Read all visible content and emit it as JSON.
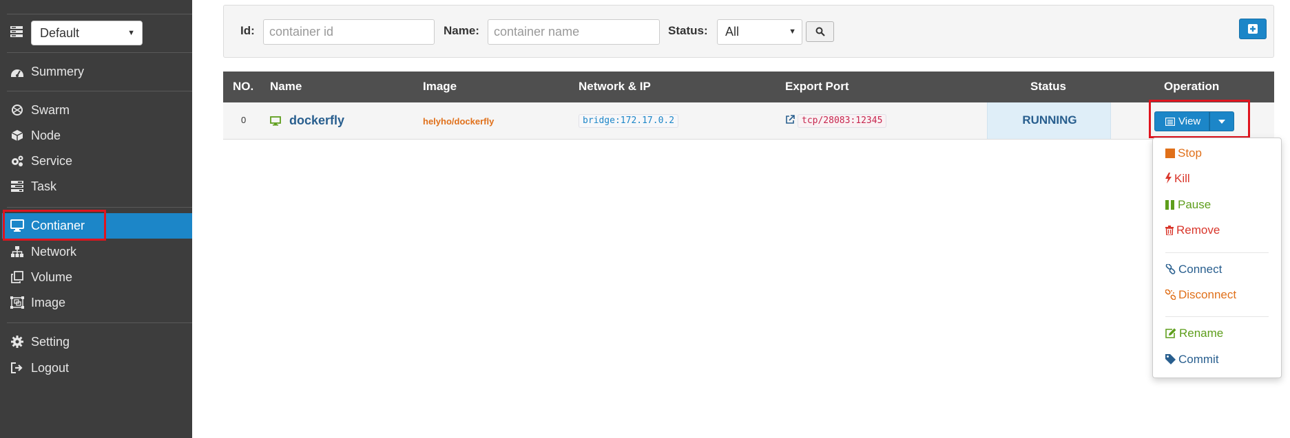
{
  "sidebar": {
    "environment": "Default",
    "items": [
      {
        "label": "Summery",
        "icon": "dashboard-icon"
      },
      {
        "label": "Swarm",
        "icon": "swarm-icon"
      },
      {
        "label": "Node",
        "icon": "cube-icon"
      },
      {
        "label": "Service",
        "icon": "cogs-icon"
      },
      {
        "label": "Task",
        "icon": "tasks-icon"
      },
      {
        "label": "Contianer",
        "icon": "desktop-icon",
        "active": true
      },
      {
        "label": "Network",
        "icon": "sitemap-icon"
      },
      {
        "label": "Volume",
        "icon": "clone-icon"
      },
      {
        "label": "Image",
        "icon": "object-group-icon"
      },
      {
        "label": "Setting",
        "icon": "gear-icon"
      },
      {
        "label": "Logout",
        "icon": "sign-out-icon"
      }
    ]
  },
  "filter": {
    "id_label": "Id:",
    "id_placeholder": "container  id",
    "name_label": "Name:",
    "name_placeholder": "container name",
    "status_label": "Status:",
    "status_value": "All"
  },
  "table": {
    "headers": [
      "NO.",
      "Name",
      "Image",
      "Network & IP",
      "Export Port",
      "Status",
      "Operation"
    ],
    "rows": [
      {
        "no": "0",
        "name": "dockerfly",
        "image": "helyho/dockerfly",
        "network": "bridge:172.17.0.2",
        "port": "tcp/28083:12345",
        "status": "RUNNING",
        "operation": "View"
      }
    ]
  },
  "dropdown": {
    "items": [
      {
        "label": "Stop",
        "icon": "stop-icon",
        "color": "#e0701a"
      },
      {
        "label": "Kill",
        "icon": "bolt-icon",
        "color": "#d9362b"
      },
      {
        "label": "Pause",
        "icon": "pause-icon",
        "color": "#5e9e1c"
      },
      {
        "label": "Remove",
        "icon": "trash-icon",
        "color": "#d9362b"
      },
      {
        "label": "Connect",
        "icon": "link-icon",
        "color": "#285e8e"
      },
      {
        "label": "Disconnect",
        "icon": "unlink-icon",
        "color": "#e0701a"
      },
      {
        "label": "Rename",
        "icon": "edit-icon",
        "color": "#5e9e1c"
      },
      {
        "label": "Commit",
        "icon": "tag-icon",
        "color": "#285e8e"
      }
    ]
  },
  "colors": {
    "sidebar_bg": "#3d3d3d",
    "accent": "#1c86c8",
    "table_header_bg": "#4f4f4f",
    "highlight": "#e0141e"
  }
}
